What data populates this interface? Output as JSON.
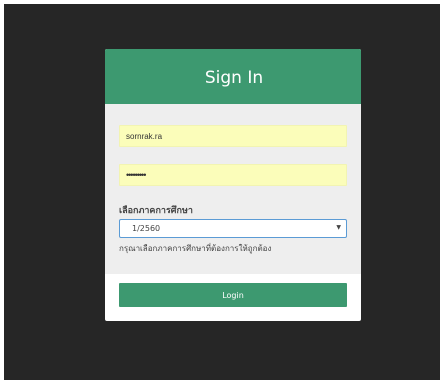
{
  "login": {
    "title": "Sign In",
    "username": {
      "value": "sornrak.ra"
    },
    "password": {
      "value": "•••••••••"
    },
    "term": {
      "label": "เลือกภาคการศึกษา",
      "selected": "1/2560",
      "help": "กรุณาเลือกภาคการศึกษาที่ต้องการให้ถูกต้อง"
    },
    "login_button": "Login"
  },
  "colors": {
    "accent": "#3d9970",
    "field_background": "#fbfdba",
    "page_background": "#262626",
    "select_border": "#5b9bd5"
  }
}
